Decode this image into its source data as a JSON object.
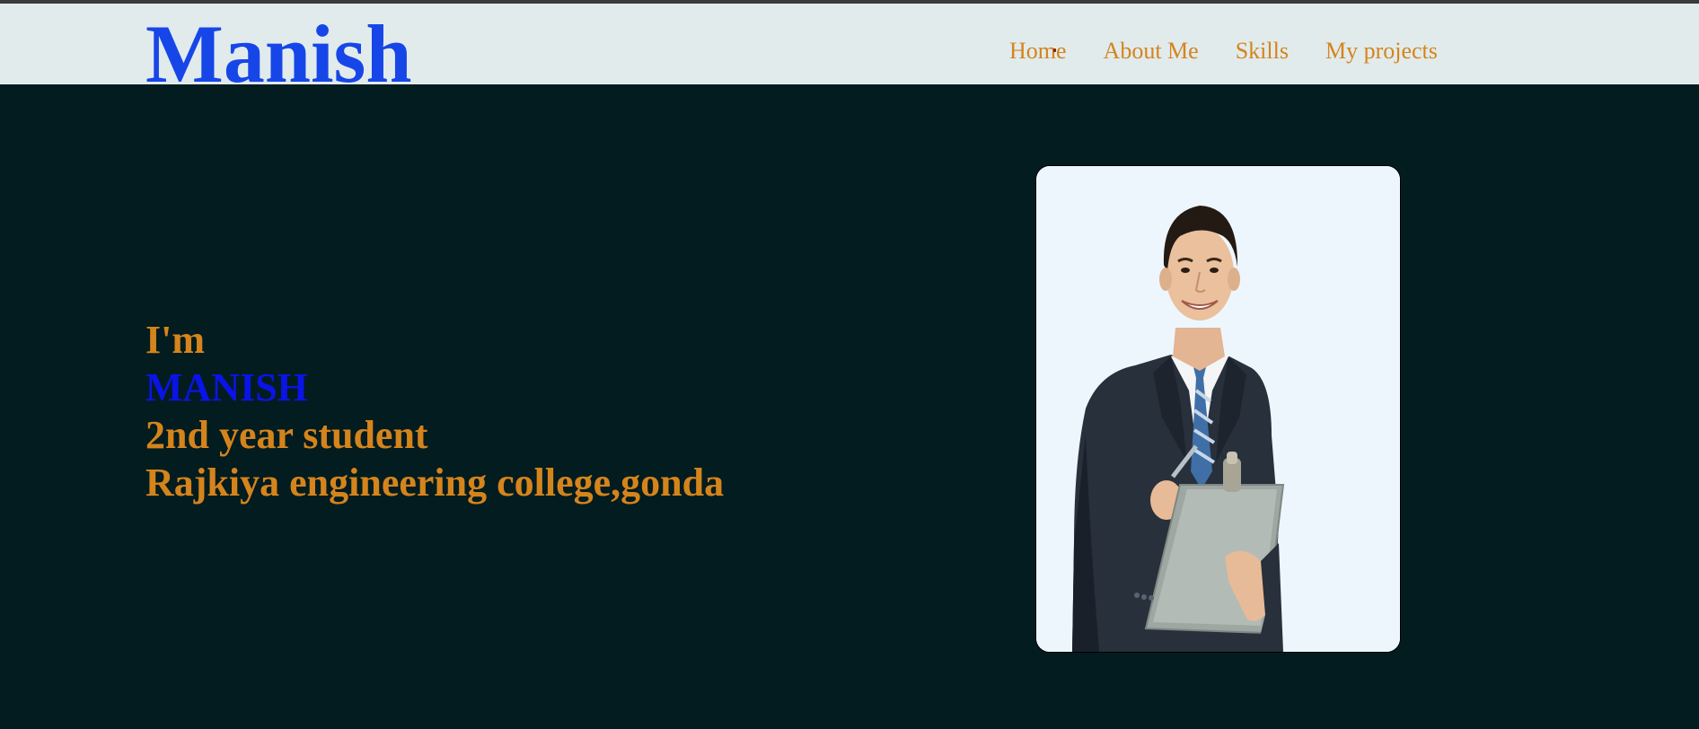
{
  "header": {
    "logo_text": "Manish",
    "nav": [
      {
        "label": "Home"
      },
      {
        "label": "About Me"
      },
      {
        "label": "Skills"
      },
      {
        "label": "My projects"
      }
    ]
  },
  "hero": {
    "lines": [
      {
        "text": "I'm",
        "color": "#d5841c"
      },
      {
        "text": "MANISH",
        "color": "#0a14e6"
      },
      {
        "text": "2nd year student",
        "color": "#d5841c"
      },
      {
        "text": "Rajkiya engineering college,gonda",
        "color": "#d5841c"
      }
    ],
    "photo": {
      "subject": "man in business suit holding clipboard"
    }
  },
  "colors": {
    "nav_bg": "#e1ebec",
    "page_bg": "#031c1f",
    "logo": "#1746e8",
    "accent": "#d5841c"
  }
}
